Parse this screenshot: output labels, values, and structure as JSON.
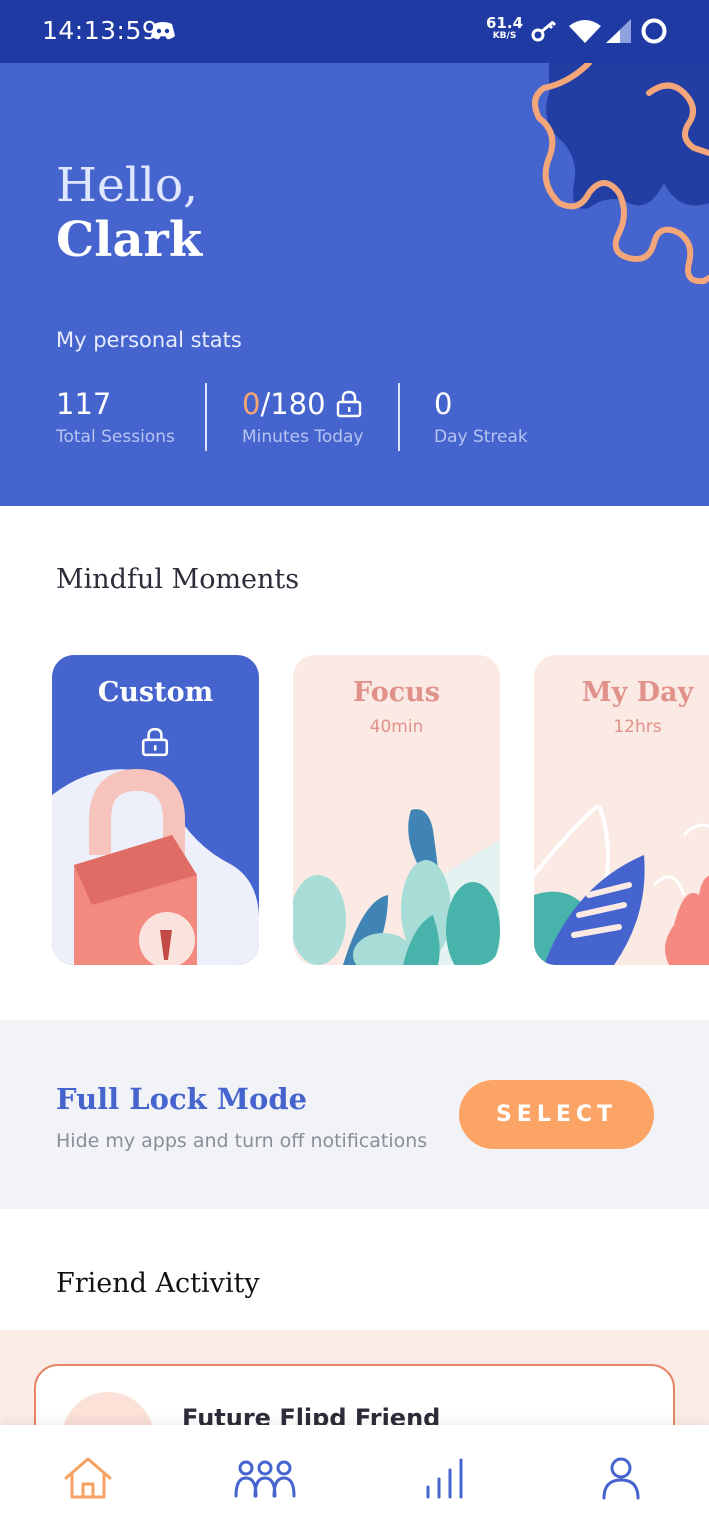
{
  "status_bar": {
    "time": "14:13:59",
    "net_speed": "61.4",
    "net_unit": "KB/S",
    "icons": [
      "discord-icon",
      "vpn-key-icon",
      "wifi-icon",
      "signal-icon",
      "battery-icon"
    ]
  },
  "hero": {
    "hello": "Hello,",
    "name": "Clark",
    "stats_title": "My personal stats",
    "stats": [
      {
        "value": "117",
        "label": "Total Sessions"
      },
      {
        "value_accent": "0",
        "value_rest": "/180",
        "label": "Minutes Today",
        "icon": "lock-icon"
      },
      {
        "value": "0",
        "label": "Day Streak"
      }
    ]
  },
  "mindful": {
    "title": "Mindful Moments",
    "cards": [
      {
        "title": "Custom",
        "icon": "lock-icon"
      },
      {
        "title": "Focus",
        "subtitle": "40min"
      },
      {
        "title": "My Day",
        "subtitle": "12hrs"
      }
    ]
  },
  "full_lock": {
    "title": "Full Lock Mode",
    "subtitle": "Hide my apps and turn off notifications",
    "button": "SELECT"
  },
  "friends": {
    "title": "Friend Activity",
    "item_name": "Future Flipd Friend"
  },
  "nav": {
    "items": [
      "home-icon",
      "community-icon",
      "stats-icon",
      "profile-icon"
    ],
    "active": "home-icon"
  },
  "colors": {
    "primary": "#4664ce",
    "status_bar": "#1f3aa3",
    "accent_orange": "#fca366",
    "card_pink": "#fbeae3",
    "heading_dark": "#2d2d3a"
  }
}
